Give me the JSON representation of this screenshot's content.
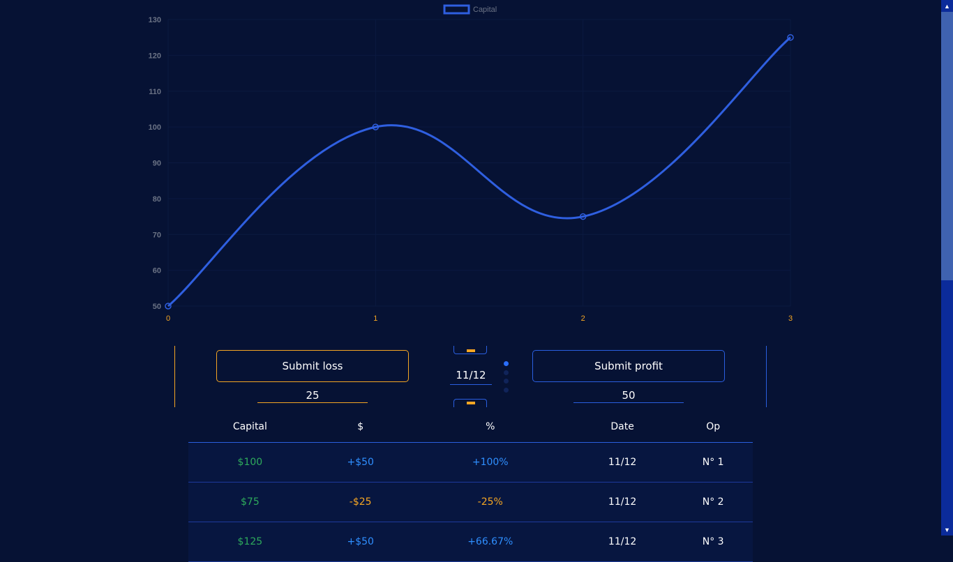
{
  "chart_data": {
    "type": "line",
    "legend": [
      "Capital"
    ],
    "legend_position": "top-center",
    "x": [
      0,
      1,
      2,
      3
    ],
    "series": [
      {
        "name": "Capital",
        "values": [
          50,
          100,
          75,
          125
        ]
      }
    ],
    "ylim": [
      50,
      130
    ],
    "yticks": [
      50,
      60,
      70,
      80,
      90,
      100,
      110,
      120,
      130
    ],
    "xticks": [
      0,
      1,
      2,
      3
    ],
    "line_color": "#2f5fe0",
    "ytick_color": "#6b7385",
    "xtick_color": "#f5a623",
    "grid": true
  },
  "controls": {
    "loss_button": "Submit loss",
    "loss_amount": "25",
    "profit_button": "Submit profit",
    "profit_amount": "50",
    "date": "11/12",
    "active_page": 1,
    "page_count": 4
  },
  "table": {
    "headers": [
      "Capital",
      "$",
      "%",
      "Date",
      "Op"
    ],
    "rows": [
      {
        "capital": "$100",
        "amount": "+$50",
        "percent": "+100%",
        "date": "11/12",
        "op": "N° 1",
        "kind": "profit"
      },
      {
        "capital": "$75",
        "amount": "-$25",
        "percent": "-25%",
        "date": "11/12",
        "op": "N° 2",
        "kind": "loss"
      },
      {
        "capital": "$125",
        "amount": "+$50",
        "percent": "+66.67%",
        "date": "11/12",
        "op": "N° 3",
        "kind": "profit"
      }
    ]
  },
  "colors": {
    "background": "#061234",
    "profit": "#2f8fff",
    "loss": "#f5a623",
    "capital": "#2eaa5c"
  }
}
